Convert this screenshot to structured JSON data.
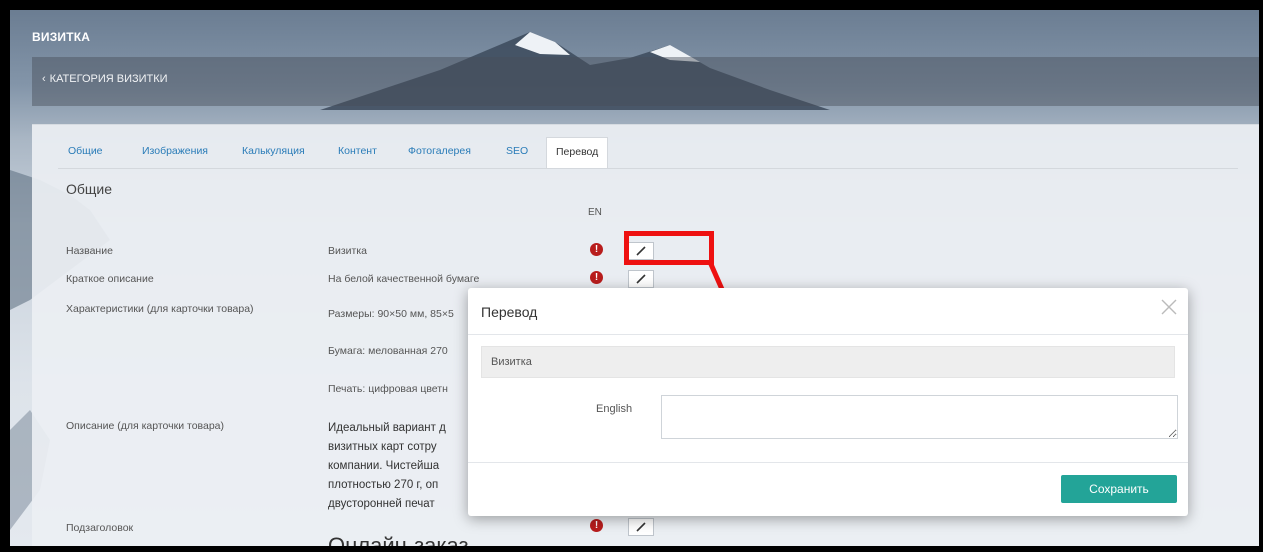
{
  "app": {
    "title": "ВИЗИТКА"
  },
  "subheader": {
    "back_label": "КАТЕГОРИЯ ВИЗИТКИ"
  },
  "tabs": [
    {
      "label": "Общие"
    },
    {
      "label": "Изображения"
    },
    {
      "label": "Калькуляция"
    },
    {
      "label": "Контент"
    },
    {
      "label": "Фотогалерея"
    },
    {
      "label": "SEO"
    },
    {
      "label": "Перевод",
      "active": true
    }
  ],
  "section": {
    "title": "Общие",
    "lang_column": "EN"
  },
  "rows": {
    "name": {
      "label": "Название",
      "value": "Визитка"
    },
    "short_desc": {
      "label": "Краткое описание",
      "value": "На белой качественной бумаге"
    },
    "characteristics": {
      "label": "Характеристики (для карточки товара)",
      "lines": [
        "Размеры: 90×50 мм, 85×5",
        "Бумага: мелованная 270",
        "Печать: цифровая цветн"
      ]
    },
    "description": {
      "label": "Описание (для карточки товара)",
      "lines": [
        "Идеальный вариант д",
        "визитных карт сотру",
        "компании. Чистейша",
        "плотностью 270 г, оп",
        "двусторонней печат"
      ]
    },
    "subtitle": {
      "label": "Подзаголовок",
      "value": "Онлайн-заказ"
    }
  },
  "icons": {
    "warning": "exclamation-circle-icon",
    "edit": "pencil-icon",
    "close": "close-x-icon"
  },
  "modal": {
    "title": "Перевод",
    "source_text": "Визитка",
    "field_label": "English",
    "field_value": "",
    "save_label": "Сохранить"
  },
  "colors": {
    "accent": "#23a498",
    "link": "#2a7cb8",
    "warning": "#b81d1d",
    "annotation": "#ee1111"
  }
}
